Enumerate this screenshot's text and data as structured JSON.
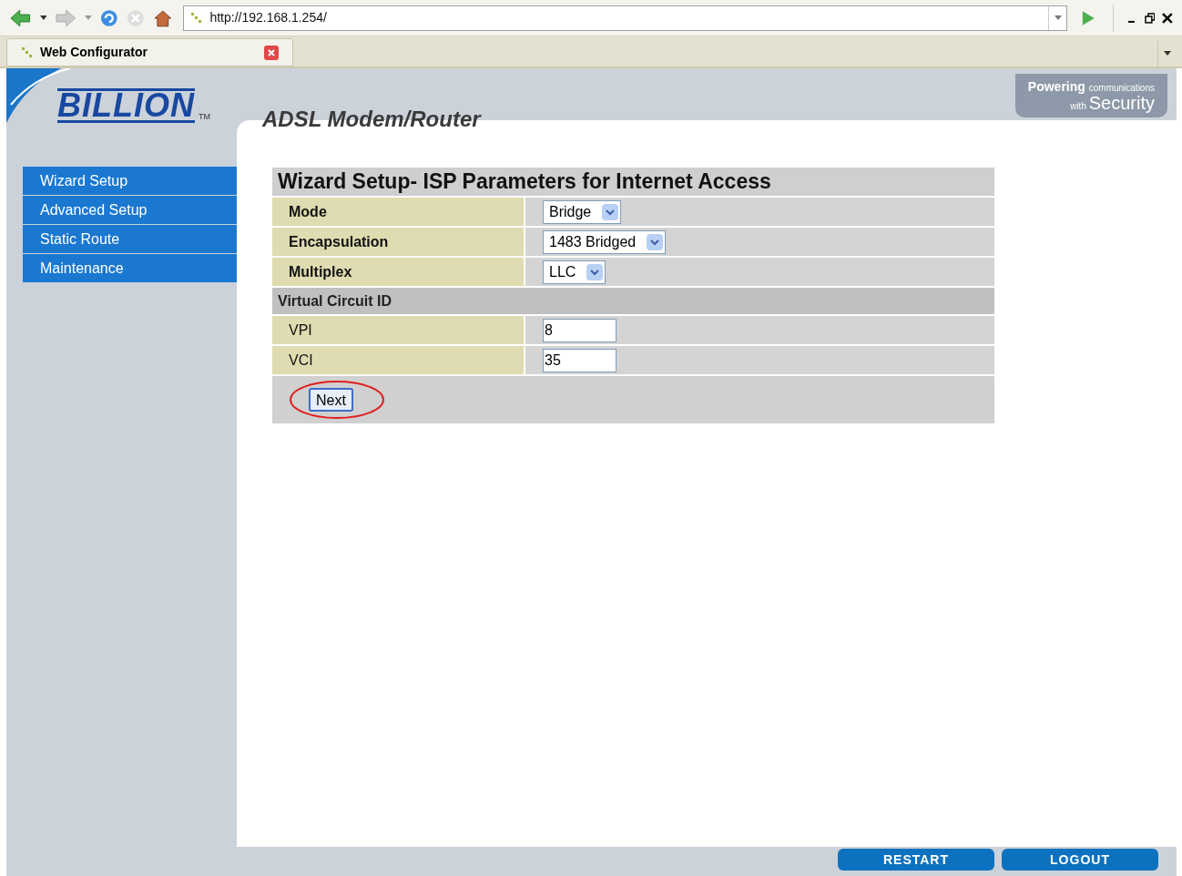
{
  "browser": {
    "url": "http://192.168.1.254/",
    "tab": {
      "title": "Web Configurator",
      "selected": true
    }
  },
  "header": {
    "logo": "BILLION",
    "trademark": "TM",
    "product": "ADSL Modem/Router",
    "slogan_1": "Powering",
    "slogan_2": "communications",
    "slogan_3": "with",
    "slogan_4": "Security"
  },
  "sidebar": {
    "items": [
      {
        "label": "Wizard Setup",
        "selected": false
      },
      {
        "label": "Advanced Setup",
        "selected": false
      },
      {
        "label": "Static Route",
        "selected": false
      },
      {
        "label": "Maintenance",
        "selected": false
      }
    ]
  },
  "form": {
    "title": "Wizard Setup- ISP Parameters for Internet Access",
    "rows": [
      {
        "kind": "select",
        "label": "Mode",
        "value": "Bridge"
      },
      {
        "kind": "select",
        "label": "Encapsulation",
        "value": "1483 Bridged"
      },
      {
        "kind": "select",
        "label": "Multiplex",
        "value": "LLC"
      },
      {
        "kind": "section",
        "label": "Virtual Circuit ID"
      },
      {
        "kind": "input",
        "label": "VPI",
        "value": "8"
      },
      {
        "kind": "input",
        "label": "VCI",
        "value": "35"
      }
    ],
    "button": {
      "label": "Next",
      "circled": true
    }
  },
  "footer": {
    "buttons": [
      "RESTART",
      "LOGOUT"
    ]
  }
}
